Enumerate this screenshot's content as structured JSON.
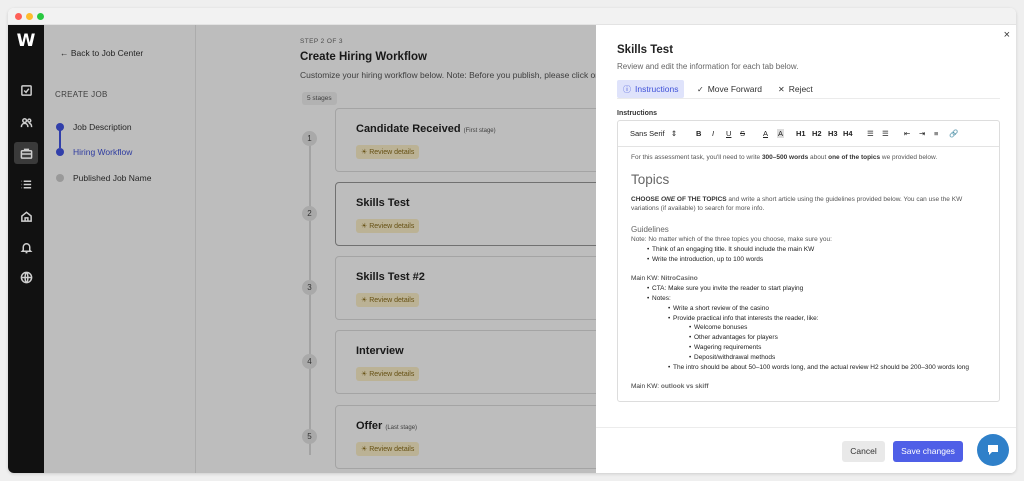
{
  "app": {
    "logo": "W"
  },
  "nav": {
    "back": "← Back to Job Center",
    "section": "CREATE JOB",
    "steps": [
      {
        "label": "Job Description"
      },
      {
        "label": "Hiring Workflow"
      },
      {
        "label": "Published Job Name"
      }
    ]
  },
  "workflow": {
    "step_label": "STEP 2 OF 3",
    "title": "Create Hiring Workflow",
    "subtitle": "Customize your hiring workflow below. Note: Before you publish, please click on",
    "stage_count": "5 stages",
    "stages": [
      {
        "num": "1",
        "name": "Candidate Received",
        "tag": "(First stage)",
        "action": "Review details"
      },
      {
        "num": "2",
        "name": "Skills Test",
        "tag": "",
        "action": "Review details"
      },
      {
        "num": "3",
        "name": "Skills Test #2",
        "tag": "",
        "action": "Review details"
      },
      {
        "num": "4",
        "name": "Interview",
        "tag": "",
        "action": "Review details"
      },
      {
        "num": "5",
        "name": "Offer",
        "tag": "(Last stage)",
        "action": "Review details"
      }
    ]
  },
  "drawer": {
    "close": "×",
    "title": "Skills Test",
    "subtitle": "Review and edit the information for each tab below.",
    "tabs": [
      {
        "icon": "ⓘ",
        "label": "Instructions"
      },
      {
        "icon": "✓",
        "label": "Move Forward"
      },
      {
        "icon": "✕",
        "label": "Reject"
      }
    ],
    "field_label": "Instructions",
    "toolbar": {
      "font": "Sans Serif",
      "bold": "B",
      "italic": "I",
      "underline": "U",
      "strike": "S",
      "color": "A",
      "bg": "A",
      "h1": "H1",
      "h2": "H2",
      "h3": "H3",
      "h4": "H4"
    },
    "content": {
      "intro_a": "For this assessment task, you'll need to write ",
      "intro_b": "300–500 words",
      "intro_c": " about ",
      "intro_d": "one of the topics",
      "intro_e": " we provided below.",
      "topics_heading": "Topics",
      "choose_a": "CHOOSE ",
      "choose_b": "ONE",
      "choose_c": " OF THE TOPICS",
      "choose_d": " and write a short article using the guidelines provided below. You can use the KW variations (if available) to search for more info.",
      "guidelines_heading": "Guidelines",
      "note": "Note: No matter which of the three topics you choose, make sure you:",
      "g1": "Think of an engaging title. It should include the main KW",
      "g2": "Write the introduction, up to 100 words",
      "mainkw_label": "Main KW: ",
      "mainkw1": "NitroCasino",
      "cta": "CTA: Make sure you invite the reader to start playing",
      "notes": "Notes:",
      "n1": "Write a short review of the casino",
      "n2": "Provide practical info that interests the reader, like:",
      "p1": "Welcome bonuses",
      "p2": "Other advantages for players",
      "p3": "Wagering requirements",
      "p4": "Deposit/withdrawal methods",
      "n3": "The intro should be about 50–100 words long, and the actual review H2 should be 200–300 words long",
      "mainkw2": "outlook vs skiff"
    },
    "cancel": "Cancel",
    "save": "Save changes"
  },
  "colors": {
    "accent": "#4f5fe7",
    "rail": "#111111",
    "chat": "#2f80c9",
    "badge": "#fcf0c9"
  }
}
